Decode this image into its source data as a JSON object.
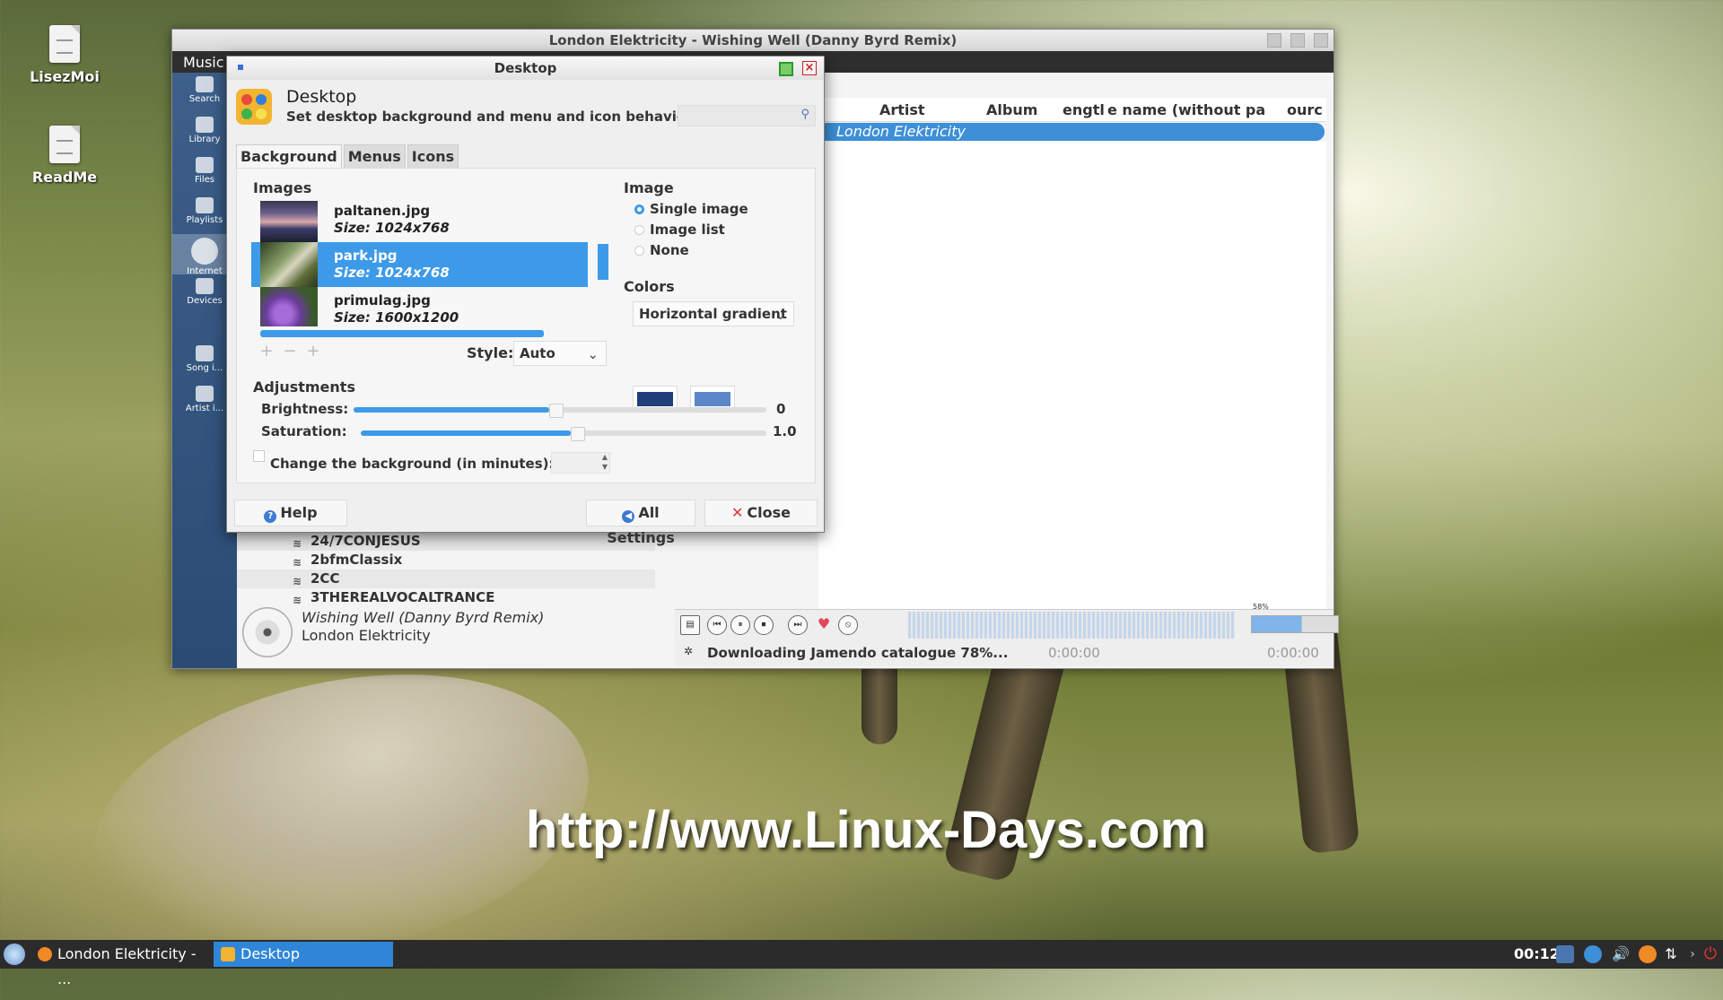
{
  "desktop": {
    "icons": [
      {
        "label": "LisezMoi"
      },
      {
        "label": "ReadMe"
      }
    ],
    "watermark": "http://www.Linux-Days.com"
  },
  "player": {
    "window_title": "London Elektricity - Wishing Well (Danny Byrd Remix)",
    "menu": "Music",
    "sidebar": [
      {
        "label": "Search",
        "icon": "search-icon"
      },
      {
        "label": "Library",
        "icon": "library-icon"
      },
      {
        "label": "Files",
        "icon": "files-icon"
      },
      {
        "label": "Playlists",
        "icon": "playlists-icon"
      },
      {
        "label": "Internet",
        "icon": "internet-icon"
      },
      {
        "label": "Devices",
        "icon": "devices-icon"
      },
      {
        "label": "Song i...",
        "icon": "song-info-icon"
      },
      {
        "label": "Artist i...",
        "icon": "artist-info-icon"
      }
    ],
    "playlist_columns": [
      "Artist",
      "Album",
      "engtl",
      "e name (without pa",
      "ourc"
    ],
    "playlist_row_artist": "London Elektricity",
    "radio_stations": [
      "24/7CONJESUS",
      "2bfmClassix",
      "2CC",
      "3THEREALVOCALTRANCE"
    ],
    "now_playing": {
      "title": "Wishing Well (Danny Byrd Remix)",
      "artist": "London Elektricity"
    },
    "volume_label": "58%",
    "volume": 0.58,
    "status": "Downloading Jamendo catalogue 78%...",
    "time_elapsed": "0:00:00",
    "time_total": "0:00:00"
  },
  "dialog": {
    "window_title": "Desktop",
    "heading": "Desktop",
    "subheading": "Set desktop background and menu and icon behaviour",
    "tabs": [
      "Background",
      "Menus",
      "Icons"
    ],
    "images_label": "Images",
    "images": [
      {
        "name": "paltanen.jpg",
        "size": "Size: 1024x768",
        "selected": false
      },
      {
        "name": "park.jpg",
        "size": "Size: 1024x768",
        "selected": true
      },
      {
        "name": "primulag.jpg",
        "size": "Size: 1600x1200",
        "selected": false
      }
    ],
    "style_label": "Style:",
    "style_value": "Auto",
    "image_section_label": "Image",
    "image_modes": [
      {
        "label": "Single image",
        "checked": true
      },
      {
        "label": "Image list",
        "checked": false
      },
      {
        "label": "None",
        "checked": false
      }
    ],
    "colors_label": "Colors",
    "colors_mode": "Horizontal gradient",
    "color1": "#1e3f7a",
    "color2": "#5b86c8",
    "adjustments_label": "Adjustments",
    "brightness_label": "Brightness:",
    "brightness_value": "0",
    "saturation_label": "Saturation:",
    "saturation_value": "1.0",
    "change_bg_label": "Change the background (in minutes):",
    "help_label": "Help",
    "all_settings_label": "All Settings",
    "close_label": "Close"
  },
  "taskbar": {
    "tasks": [
      {
        "label": "London Elektricity - ...",
        "active": false
      },
      {
        "label": "Desktop",
        "active": true
      }
    ],
    "clock": "00:12"
  }
}
